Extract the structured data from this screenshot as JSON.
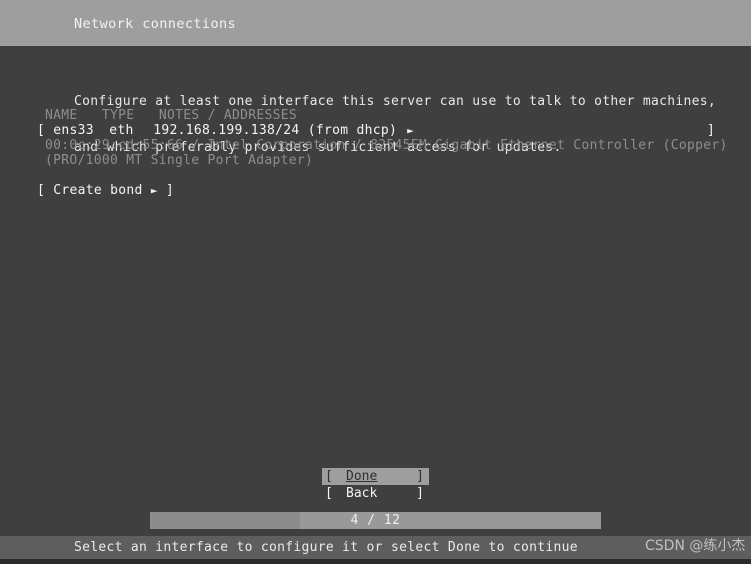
{
  "window": {
    "title": "Network connections"
  },
  "intro": {
    "line1": "Configure at least one interface this server can use to talk to other machines,",
    "line2": "and which preferably provides sufficient access for updates."
  },
  "table": {
    "headers": {
      "name": "NAME",
      "type": "TYPE",
      "notes": "NOTES / ADDRESSES"
    },
    "rows": [
      {
        "bracket_left": "[",
        "name": "ens33",
        "type": "eth",
        "notes": "192.168.199.138/24 (from dhcp)",
        "arrow": "►",
        "bracket_right": "]",
        "detail_line1": "00:0c:29:cd:55:66 / Intel Corporation / 82545EM Gigabit Ethernet Controller (Copper)",
        "detail_line2": "(PRO/1000 MT Single Port Adapter)"
      }
    ]
  },
  "actions": {
    "create_bond": {
      "bracket_left": "[",
      "label": "Create bond",
      "arrow": "►",
      "bracket_right": "]"
    }
  },
  "buttons": [
    {
      "bracket_left": "[",
      "label": "Done",
      "bracket_right": "]",
      "selected": true
    },
    {
      "bracket_left": "[",
      "label": "Back",
      "bracket_right": "]",
      "selected": false
    }
  ],
  "progress": {
    "text": "4 / 12",
    "current": 4,
    "total": 12
  },
  "statusbar": {
    "hint": "Select an interface to configure it or select Done to continue"
  },
  "watermark": {
    "text": "CSDN @练小杰"
  },
  "colors": {
    "header_bg": "#9e9e9e",
    "body_bg": "#3f3f3f",
    "text": "#f4f4f4",
    "dim_text": "#8e8e8e",
    "selected_bg": "#9e9e9e",
    "selected_text": "#303030",
    "statusbar_bg": "#5e5e5e",
    "progress_bg": "#999999",
    "progress_fill": "#8c8c8c"
  }
}
